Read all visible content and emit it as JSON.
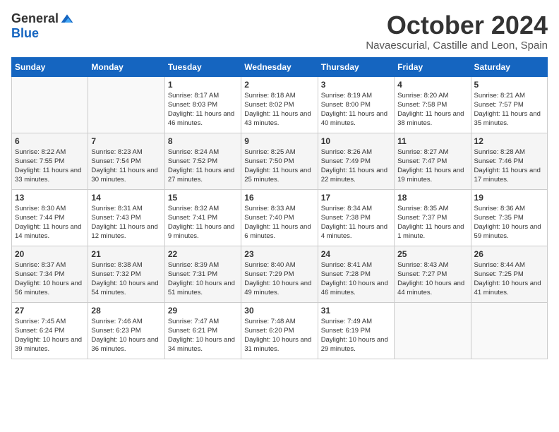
{
  "logo": {
    "general": "General",
    "blue": "Blue"
  },
  "header": {
    "month": "October 2024",
    "location": "Navaescurial, Castille and Leon, Spain"
  },
  "days_of_week": [
    "Sunday",
    "Monday",
    "Tuesday",
    "Wednesday",
    "Thursday",
    "Friday",
    "Saturday"
  ],
  "weeks": [
    [
      {
        "day": "",
        "sunrise": "",
        "sunset": "",
        "daylight": ""
      },
      {
        "day": "",
        "sunrise": "",
        "sunset": "",
        "daylight": ""
      },
      {
        "day": "1",
        "sunrise": "Sunrise: 8:17 AM",
        "sunset": "Sunset: 8:03 PM",
        "daylight": "Daylight: 11 hours and 46 minutes."
      },
      {
        "day": "2",
        "sunrise": "Sunrise: 8:18 AM",
        "sunset": "Sunset: 8:02 PM",
        "daylight": "Daylight: 11 hours and 43 minutes."
      },
      {
        "day": "3",
        "sunrise": "Sunrise: 8:19 AM",
        "sunset": "Sunset: 8:00 PM",
        "daylight": "Daylight: 11 hours and 40 minutes."
      },
      {
        "day": "4",
        "sunrise": "Sunrise: 8:20 AM",
        "sunset": "Sunset: 7:58 PM",
        "daylight": "Daylight: 11 hours and 38 minutes."
      },
      {
        "day": "5",
        "sunrise": "Sunrise: 8:21 AM",
        "sunset": "Sunset: 7:57 PM",
        "daylight": "Daylight: 11 hours and 35 minutes."
      }
    ],
    [
      {
        "day": "6",
        "sunrise": "Sunrise: 8:22 AM",
        "sunset": "Sunset: 7:55 PM",
        "daylight": "Daylight: 11 hours and 33 minutes."
      },
      {
        "day": "7",
        "sunrise": "Sunrise: 8:23 AM",
        "sunset": "Sunset: 7:54 PM",
        "daylight": "Daylight: 11 hours and 30 minutes."
      },
      {
        "day": "8",
        "sunrise": "Sunrise: 8:24 AM",
        "sunset": "Sunset: 7:52 PM",
        "daylight": "Daylight: 11 hours and 27 minutes."
      },
      {
        "day": "9",
        "sunrise": "Sunrise: 8:25 AM",
        "sunset": "Sunset: 7:50 PM",
        "daylight": "Daylight: 11 hours and 25 minutes."
      },
      {
        "day": "10",
        "sunrise": "Sunrise: 8:26 AM",
        "sunset": "Sunset: 7:49 PM",
        "daylight": "Daylight: 11 hours and 22 minutes."
      },
      {
        "day": "11",
        "sunrise": "Sunrise: 8:27 AM",
        "sunset": "Sunset: 7:47 PM",
        "daylight": "Daylight: 11 hours and 19 minutes."
      },
      {
        "day": "12",
        "sunrise": "Sunrise: 8:28 AM",
        "sunset": "Sunset: 7:46 PM",
        "daylight": "Daylight: 11 hours and 17 minutes."
      }
    ],
    [
      {
        "day": "13",
        "sunrise": "Sunrise: 8:30 AM",
        "sunset": "Sunset: 7:44 PM",
        "daylight": "Daylight: 11 hours and 14 minutes."
      },
      {
        "day": "14",
        "sunrise": "Sunrise: 8:31 AM",
        "sunset": "Sunset: 7:43 PM",
        "daylight": "Daylight: 11 hours and 12 minutes."
      },
      {
        "day": "15",
        "sunrise": "Sunrise: 8:32 AM",
        "sunset": "Sunset: 7:41 PM",
        "daylight": "Daylight: 11 hours and 9 minutes."
      },
      {
        "day": "16",
        "sunrise": "Sunrise: 8:33 AM",
        "sunset": "Sunset: 7:40 PM",
        "daylight": "Daylight: 11 hours and 6 minutes."
      },
      {
        "day": "17",
        "sunrise": "Sunrise: 8:34 AM",
        "sunset": "Sunset: 7:38 PM",
        "daylight": "Daylight: 11 hours and 4 minutes."
      },
      {
        "day": "18",
        "sunrise": "Sunrise: 8:35 AM",
        "sunset": "Sunset: 7:37 PM",
        "daylight": "Daylight: 11 hours and 1 minute."
      },
      {
        "day": "19",
        "sunrise": "Sunrise: 8:36 AM",
        "sunset": "Sunset: 7:35 PM",
        "daylight": "Daylight: 10 hours and 59 minutes."
      }
    ],
    [
      {
        "day": "20",
        "sunrise": "Sunrise: 8:37 AM",
        "sunset": "Sunset: 7:34 PM",
        "daylight": "Daylight: 10 hours and 56 minutes."
      },
      {
        "day": "21",
        "sunrise": "Sunrise: 8:38 AM",
        "sunset": "Sunset: 7:32 PM",
        "daylight": "Daylight: 10 hours and 54 minutes."
      },
      {
        "day": "22",
        "sunrise": "Sunrise: 8:39 AM",
        "sunset": "Sunset: 7:31 PM",
        "daylight": "Daylight: 10 hours and 51 minutes."
      },
      {
        "day": "23",
        "sunrise": "Sunrise: 8:40 AM",
        "sunset": "Sunset: 7:29 PM",
        "daylight": "Daylight: 10 hours and 49 minutes."
      },
      {
        "day": "24",
        "sunrise": "Sunrise: 8:41 AM",
        "sunset": "Sunset: 7:28 PM",
        "daylight": "Daylight: 10 hours and 46 minutes."
      },
      {
        "day": "25",
        "sunrise": "Sunrise: 8:43 AM",
        "sunset": "Sunset: 7:27 PM",
        "daylight": "Daylight: 10 hours and 44 minutes."
      },
      {
        "day": "26",
        "sunrise": "Sunrise: 8:44 AM",
        "sunset": "Sunset: 7:25 PM",
        "daylight": "Daylight: 10 hours and 41 minutes."
      }
    ],
    [
      {
        "day": "27",
        "sunrise": "Sunrise: 7:45 AM",
        "sunset": "Sunset: 6:24 PM",
        "daylight": "Daylight: 10 hours and 39 minutes."
      },
      {
        "day": "28",
        "sunrise": "Sunrise: 7:46 AM",
        "sunset": "Sunset: 6:23 PM",
        "daylight": "Daylight: 10 hours and 36 minutes."
      },
      {
        "day": "29",
        "sunrise": "Sunrise: 7:47 AM",
        "sunset": "Sunset: 6:21 PM",
        "daylight": "Daylight: 10 hours and 34 minutes."
      },
      {
        "day": "30",
        "sunrise": "Sunrise: 7:48 AM",
        "sunset": "Sunset: 6:20 PM",
        "daylight": "Daylight: 10 hours and 31 minutes."
      },
      {
        "day": "31",
        "sunrise": "Sunrise: 7:49 AM",
        "sunset": "Sunset: 6:19 PM",
        "daylight": "Daylight: 10 hours and 29 minutes."
      },
      {
        "day": "",
        "sunrise": "",
        "sunset": "",
        "daylight": ""
      },
      {
        "day": "",
        "sunrise": "",
        "sunset": "",
        "daylight": ""
      }
    ]
  ]
}
